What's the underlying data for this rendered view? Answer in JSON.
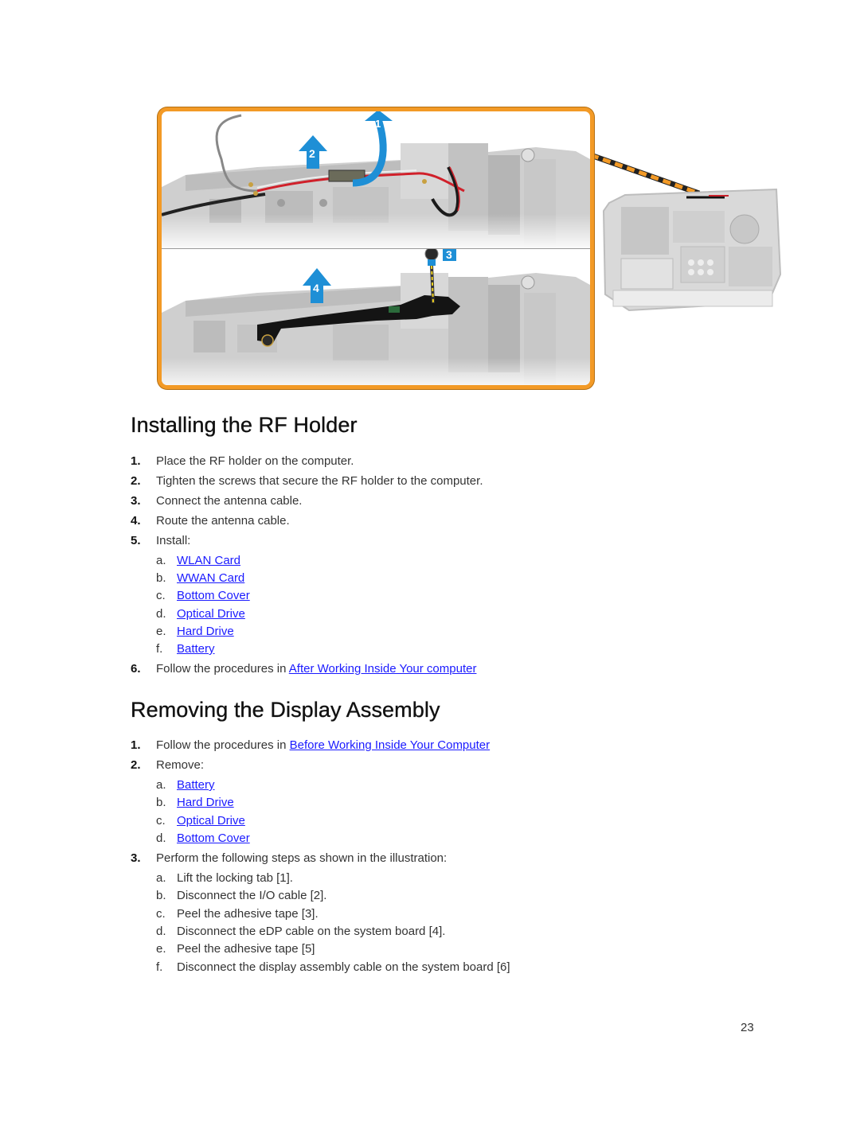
{
  "illustration": {
    "callouts": [
      "1",
      "2",
      "3",
      "4"
    ],
    "colors": {
      "frame": "#f39a26",
      "arrow": "#1e8fd6",
      "badge": "#1e8fd6",
      "callout_dash": "#f39a26"
    }
  },
  "install_section": {
    "title": "Installing the RF Holder",
    "steps": [
      {
        "num": "1.",
        "text": "Place the RF holder on the computer."
      },
      {
        "num": "2.",
        "text": "Tighten the screws that secure the RF holder to the computer."
      },
      {
        "num": "3.",
        "text": "Connect the antenna cable."
      },
      {
        "num": "4.",
        "text": "Route the antenna cable."
      },
      {
        "num": "5.",
        "text": "Install:"
      },
      {
        "num": "6.",
        "text": "Follow the procedures in ",
        "link": "After Working Inside Your computer"
      }
    ],
    "install_items": [
      {
        "letter": "a.",
        "link": "WLAN Card"
      },
      {
        "letter": "b.",
        "link": "WWAN Card"
      },
      {
        "letter": "c.",
        "link": "Bottom Cover"
      },
      {
        "letter": "d.",
        "link": "Optical Drive"
      },
      {
        "letter": "e.",
        "link": "Hard Drive"
      },
      {
        "letter": "f.",
        "link": "Battery"
      }
    ]
  },
  "remove_section": {
    "title": "Removing the Display Assembly",
    "steps": [
      {
        "num": "1.",
        "text": "Follow the procedures in ",
        "link": "Before Working Inside Your Computer"
      },
      {
        "num": "2.",
        "text": "Remove:"
      },
      {
        "num": "3.",
        "text": "Perform the following steps as shown in the illustration:"
      }
    ],
    "remove_items": [
      {
        "letter": "a.",
        "link": "Battery"
      },
      {
        "letter": "b.",
        "link": "Hard Drive"
      },
      {
        "letter": "c.",
        "link": "Optical Drive"
      },
      {
        "letter": "d.",
        "link": "Bottom Cover"
      }
    ],
    "illustration_steps": [
      {
        "letter": "a.",
        "text": "Lift the locking tab [1]."
      },
      {
        "letter": "b.",
        "text": "Disconnect the I/O cable [2]."
      },
      {
        "letter": "c.",
        "text": "Peel the adhesive tape [3]."
      },
      {
        "letter": "d.",
        "text": "Disconnect the eDP cable on the system board [4]."
      },
      {
        "letter": "e.",
        "text": "Peel the adhesive tape [5]"
      },
      {
        "letter": "f.",
        "text": "Disconnect the display assembly cable on the system board [6]"
      }
    ]
  },
  "page_number": "23"
}
